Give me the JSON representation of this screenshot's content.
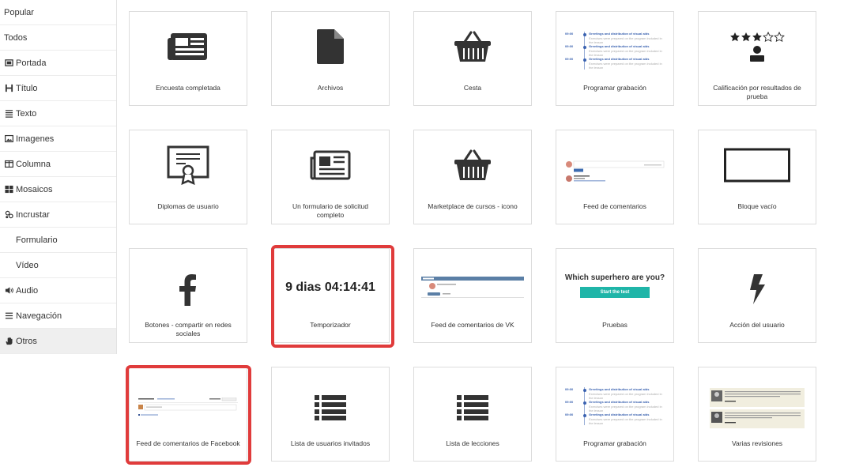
{
  "sidebar": {
    "items": [
      {
        "label": "Popular",
        "icon": "",
        "indent": false,
        "active": false
      },
      {
        "label": "Todos",
        "icon": "",
        "indent": false,
        "active": false
      },
      {
        "label": "Portada",
        "icon": "cover-icon",
        "indent": false,
        "active": false
      },
      {
        "label": "Título",
        "icon": "heading-icon",
        "indent": false,
        "active": false
      },
      {
        "label": "Texto",
        "icon": "text-lines-icon",
        "indent": false,
        "active": false
      },
      {
        "label": "Imagenes",
        "icon": "image-icon",
        "indent": false,
        "active": false
      },
      {
        "label": "Columna",
        "icon": "columns-icon",
        "indent": false,
        "active": false
      },
      {
        "label": "Mosaicos",
        "icon": "tiles-icon",
        "indent": false,
        "active": false
      },
      {
        "label": "Incrustar",
        "icon": "embed-icon",
        "indent": false,
        "active": false
      },
      {
        "label": "Formulario",
        "icon": "",
        "indent": true,
        "active": false
      },
      {
        "label": "Vídeo",
        "icon": "",
        "indent": true,
        "active": false
      },
      {
        "label": "Audio",
        "icon": "speaker-icon",
        "indent": false,
        "active": false
      },
      {
        "label": "Navegación",
        "icon": "menu-icon",
        "indent": false,
        "active": false
      },
      {
        "label": "Otros",
        "icon": "hand-icon",
        "indent": false,
        "active": true
      }
    ]
  },
  "tiles": [
    {
      "label": "Encuesta completada",
      "icon": "newspaper-icon"
    },
    {
      "label": "Archivos",
      "icon": "file-icon"
    },
    {
      "label": "Cesta",
      "icon": "basket-icon"
    },
    {
      "label": "Programar grabación",
      "icon": "schedule-preview"
    },
    {
      "label": "Calificación por resultados de prueba",
      "icon": "rating-user-icon"
    },
    {
      "label": "Diplomas de usuario",
      "icon": "certificate-icon"
    },
    {
      "label": "Un formulario de solicitud completo",
      "icon": "newspaper-outline-icon"
    },
    {
      "label": "Marketplace de cursos - icono",
      "icon": "basket-icon"
    },
    {
      "label": "Feed de comentarios",
      "icon": "comments-preview"
    },
    {
      "label": "Bloque vacío",
      "icon": "empty-block-icon"
    },
    {
      "label": "Botones - compartir en redes sociales",
      "icon": "facebook-icon"
    },
    {
      "label": "Temporizador",
      "icon": "timer-preview"
    },
    {
      "label": "Feed de comentarios de VK",
      "icon": "vk-comments-preview"
    },
    {
      "label": "Pruebas",
      "icon": "quiz-preview"
    },
    {
      "label": "Acción del usuario",
      "icon": "lightning-icon"
    },
    {
      "label": "Feed de comentarios de Facebook",
      "icon": "fb-comments-preview"
    },
    {
      "label": "Lista de usuarios invitados",
      "icon": "list-icon"
    },
    {
      "label": "Lista de lecciones",
      "icon": "list-icon"
    },
    {
      "label": "Programar grabación",
      "icon": "schedule-preview"
    },
    {
      "label": "Varias revisiones",
      "icon": "reviews-preview"
    }
  ],
  "timer": {
    "text": "9 dias 04:14:41"
  },
  "quiz": {
    "question": "Which superhero are you?",
    "button": "Start the test"
  },
  "schedule": {
    "rows": [
      {
        "time": "09:00",
        "title": "Greetings and distribution of visual aids",
        "sub": "Exercises were prepared on the program included in the lesson"
      },
      {
        "time": "09:00",
        "title": "Greetings and distribution of visual aids",
        "sub": "Exercises were prepared on the program included in the lesson"
      },
      {
        "time": "09:00",
        "title": "Greetings and distribution of visual aids",
        "sub": "Exercises were prepared on the program included in the lesson"
      }
    ]
  },
  "colors": {
    "highlight": "#e03b3b",
    "accent": "#1fb5a8",
    "link": "#3a62b0"
  }
}
